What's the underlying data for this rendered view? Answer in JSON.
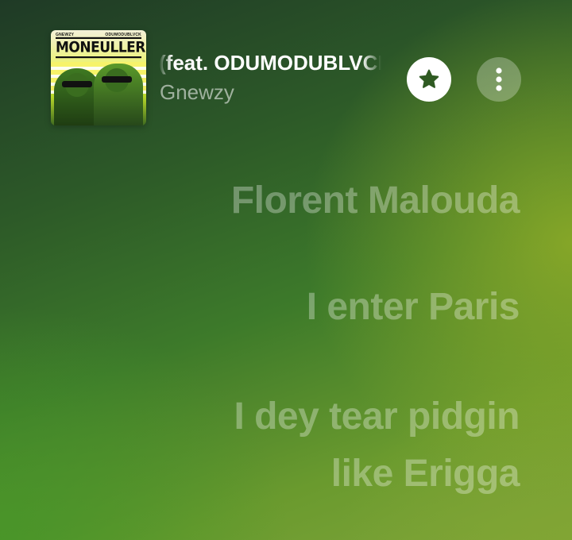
{
  "now_playing": {
    "title": "(feat. ODUMODUBLVCK)",
    "artist": "Gnewzy",
    "album_art": {
      "cover_title": "MONEULLER",
      "cover_artist_left": "GNEWZY",
      "cover_artist_right": "ODUMODUBLVCK"
    }
  },
  "controls": {
    "favorite_icon": "star-icon",
    "more_icon": "more-vertical-icon"
  },
  "lyrics": [
    "Florent Malouda",
    "I enter Paris",
    "I dey tear pidgin",
    "like Erigga"
  ],
  "colors": {
    "background_dark": "#1f3a26",
    "background_mid": "#3d7a2a",
    "background_light": "#7fa53a",
    "lyric_inactive": "rgba(255,255,255,0.32)",
    "button_favorite_bg": "#ffffff",
    "button_more_bg": "rgba(255,255,255,0.28)"
  }
}
